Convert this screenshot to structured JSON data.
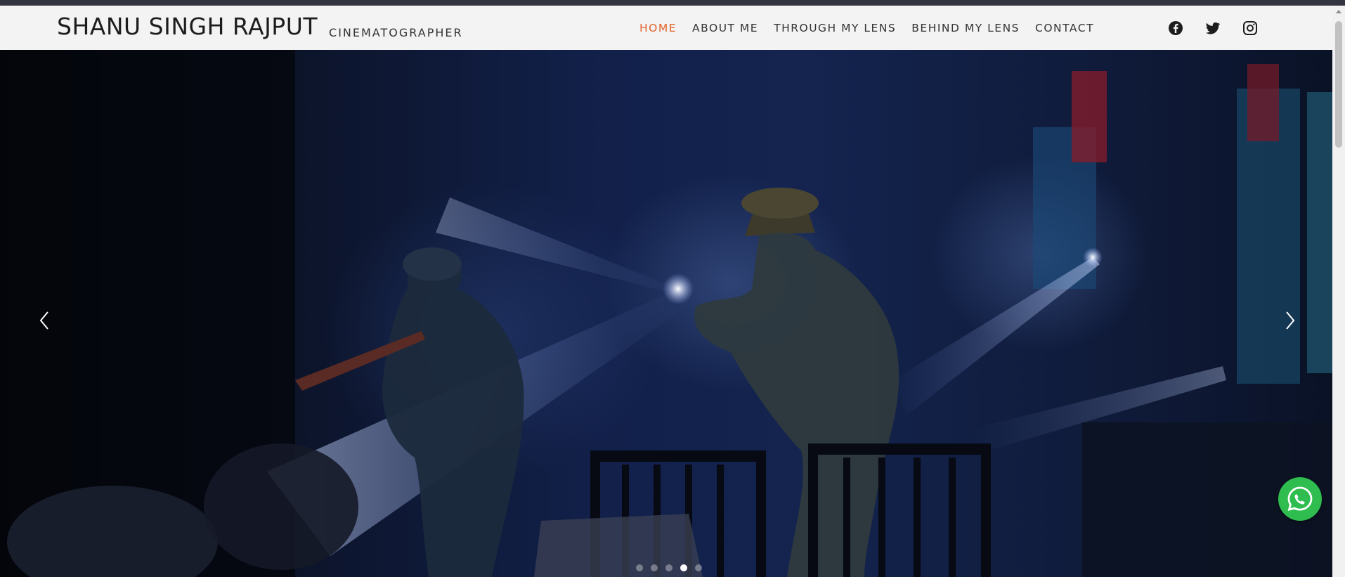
{
  "header": {
    "brand_name": "SHANU SINGH RAJPUT",
    "brand_tagline": "CINEMATOGRAPHER",
    "nav": [
      {
        "label": "HOME",
        "active": true
      },
      {
        "label": "ABOUT ME",
        "active": false
      },
      {
        "label": "THROUGH MY LENS",
        "active": false
      },
      {
        "label": "BEHIND MY LENS",
        "active": false
      },
      {
        "label": "CONTACT",
        "active": false
      }
    ],
    "social_icons": [
      "facebook-icon",
      "twitter-icon",
      "instagram-icon"
    ],
    "active_color": "#e2632a"
  },
  "hero": {
    "slides_total": 5,
    "active_slide": 4,
    "prev_icon": "chevron-left-icon",
    "next_icon": "chevron-right-icon"
  },
  "floating": {
    "whatsapp_icon": "whatsapp-icon",
    "whatsapp_color": "#2fbd4f"
  }
}
